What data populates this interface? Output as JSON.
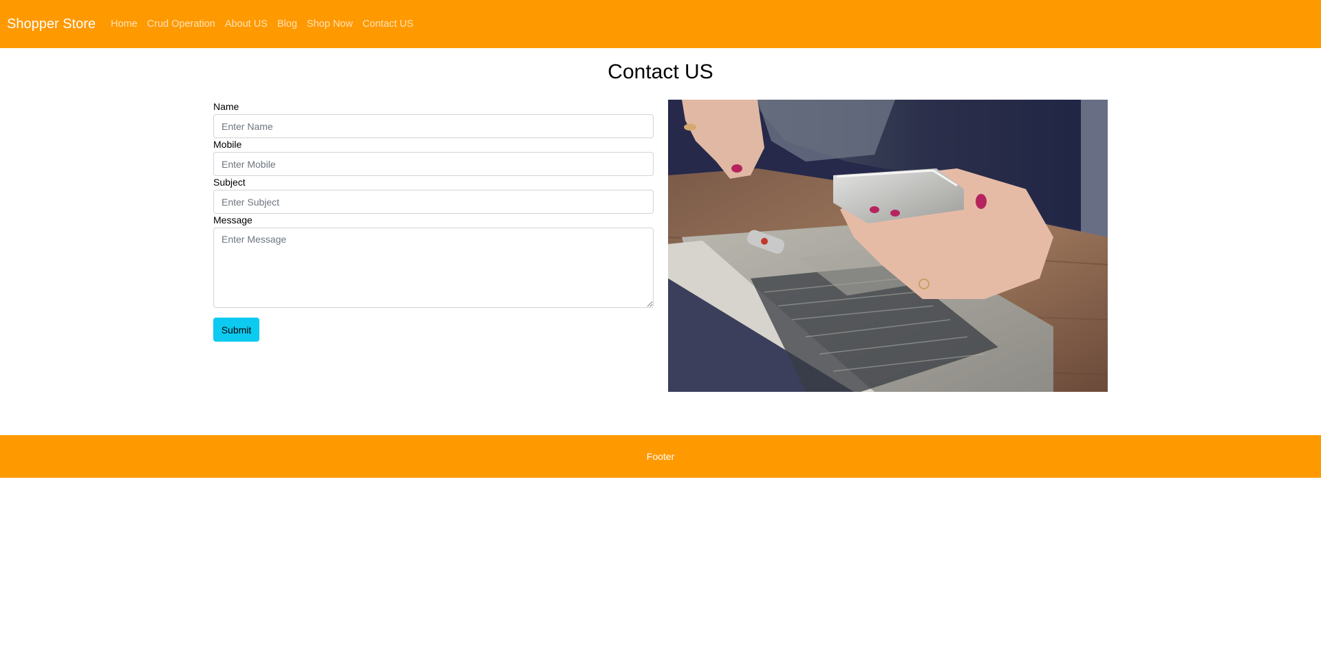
{
  "navbar": {
    "brand": "Shopper Store",
    "links": [
      {
        "label": "Home"
      },
      {
        "label": "Crud Operation"
      },
      {
        "label": "About US"
      },
      {
        "label": "Blog"
      },
      {
        "label": "Shop Now"
      },
      {
        "label": "Contact US"
      }
    ]
  },
  "page": {
    "title": "Contact US"
  },
  "form": {
    "name": {
      "label": "Name",
      "placeholder": "Enter Name",
      "value": ""
    },
    "mobile": {
      "label": "Mobile",
      "placeholder": "Enter Mobile",
      "value": ""
    },
    "subject": {
      "label": "Subject",
      "placeholder": "Enter Subject",
      "value": ""
    },
    "message": {
      "label": "Message",
      "placeholder": "Enter Message",
      "value": ""
    },
    "submit_label": "Submit"
  },
  "image": {
    "subject": "hands holding smartphone over laptop on wooden desk"
  },
  "footer": {
    "text": "Footer"
  },
  "colors": {
    "brand_orange": "#ff9900",
    "submit_cyan": "#0dcaf0"
  }
}
